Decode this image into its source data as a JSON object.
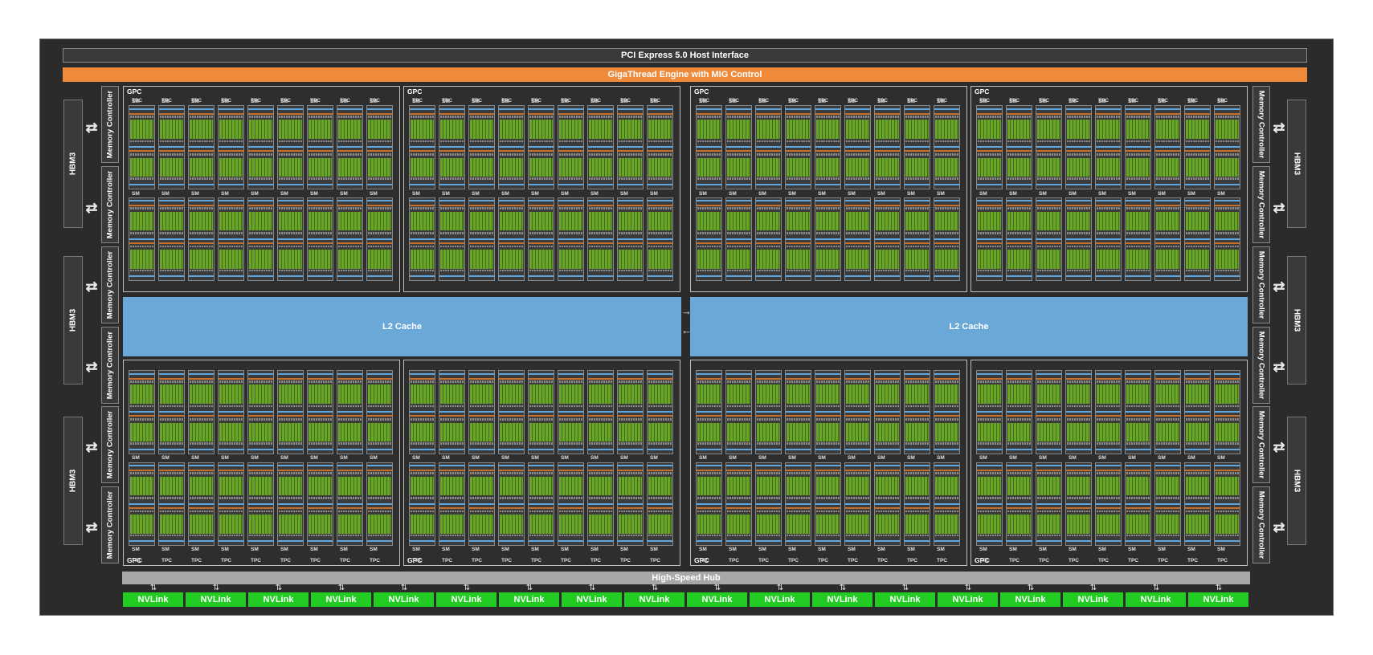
{
  "pcie": "PCI Express 5.0 Host Interface",
  "gigathread": "GigaThread Engine with MIG Control",
  "hbm_label": "HBM3",
  "memory_controller_label": "Memory Controller",
  "gpc_label": "GPC",
  "tpc_label": "TPC",
  "sm_label": "SM",
  "l2_cache": "L2 Cache",
  "high_speed_hub": "High-Speed Hub",
  "nvlink_label": "NVLink",
  "nvlink_count": 18,
  "gpc_count": 8,
  "tpcs_per_gpc": 9,
  "sms_per_tpc": 2,
  "hbm_stacks_per_side": 3,
  "memory_controllers_per_side": 6,
  "colors": {
    "background": "#2b2b2b",
    "gigathread": "#ee8a3a",
    "l2_cache": "#6aa8d8",
    "nvlink": "#22cc22",
    "hub": "#a8a8a8",
    "sm_core": "#6aa52a"
  },
  "icons": {
    "bidirectional_arrow": "⇄"
  }
}
